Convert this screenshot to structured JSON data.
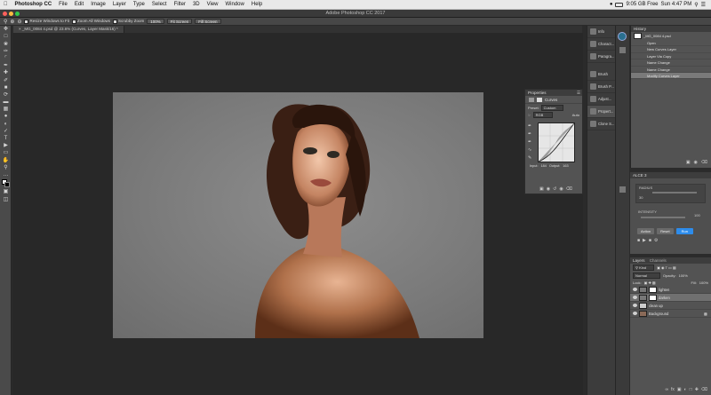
{
  "menubar": {
    "apple": "",
    "items": [
      "Photoshop CC",
      "File",
      "Edit",
      "Image",
      "Layer",
      "Type",
      "Select",
      "Filter",
      "3D",
      "View",
      "Window",
      "Help"
    ],
    "status": "9:05 GB Free",
    "clock": "Sun 4:47 PM"
  },
  "window": {
    "title": "Adobe Photoshop CC 2017"
  },
  "options": {
    "resize_windows": "Resize Windows to Fit",
    "zoom_all": "Zoom All Windows",
    "scrubby": "Scrubby Zoom",
    "zoom_pct": "100%",
    "fit_screen": "Fit Screen",
    "fill_screen": "Fill Screen"
  },
  "document": {
    "tab": "_MG_0084 4.psd @ 23.6% (Curves, Layer Mask/16) *"
  },
  "properties": {
    "panel_title": "Properties",
    "type": "Curves",
    "preset_label": "Preset:",
    "preset": "Custom",
    "channel": "RGB",
    "auto": "Auto",
    "input_label": "Input:",
    "input_value": "184",
    "output_label": "Output:",
    "output_value": "163"
  },
  "dock": {
    "items": [
      "Info",
      "Charact...",
      "Paragra...",
      "Brush",
      "Brush P...",
      "Adjust...",
      "Propert...",
      "Clone S..."
    ]
  },
  "history": {
    "title": "History",
    "snapshot": "_MG_0084 4.psd",
    "items": [
      "Open",
      "New Curves Layer",
      "Layer Via Copy",
      "Name Change",
      "Name Change",
      "Modify Curves Layer"
    ]
  },
  "alce": {
    "title": "ALCE 3",
    "radius_label": "RADIUS",
    "radius_value": "30",
    "intensity_label": "INTENSITY",
    "intensity_value": "100",
    "buttons": [
      "Action",
      "Reset",
      "Run"
    ]
  },
  "layers": {
    "tabs": [
      "Layers",
      "Channels"
    ],
    "kind": "Kind",
    "blend": "Normal",
    "opacity_label": "Opacity:",
    "opacity": "100%",
    "lock_label": "Lock:",
    "fill_label": "Fill:",
    "fill": "100%",
    "rows": [
      {
        "name": "lighten"
      },
      {
        "name": "darken"
      },
      {
        "name": "clean up"
      },
      {
        "name": "Background"
      }
    ]
  },
  "colors": {
    "accent": "#2d8ceb",
    "panel": "#535353",
    "canvas": "#282828"
  }
}
